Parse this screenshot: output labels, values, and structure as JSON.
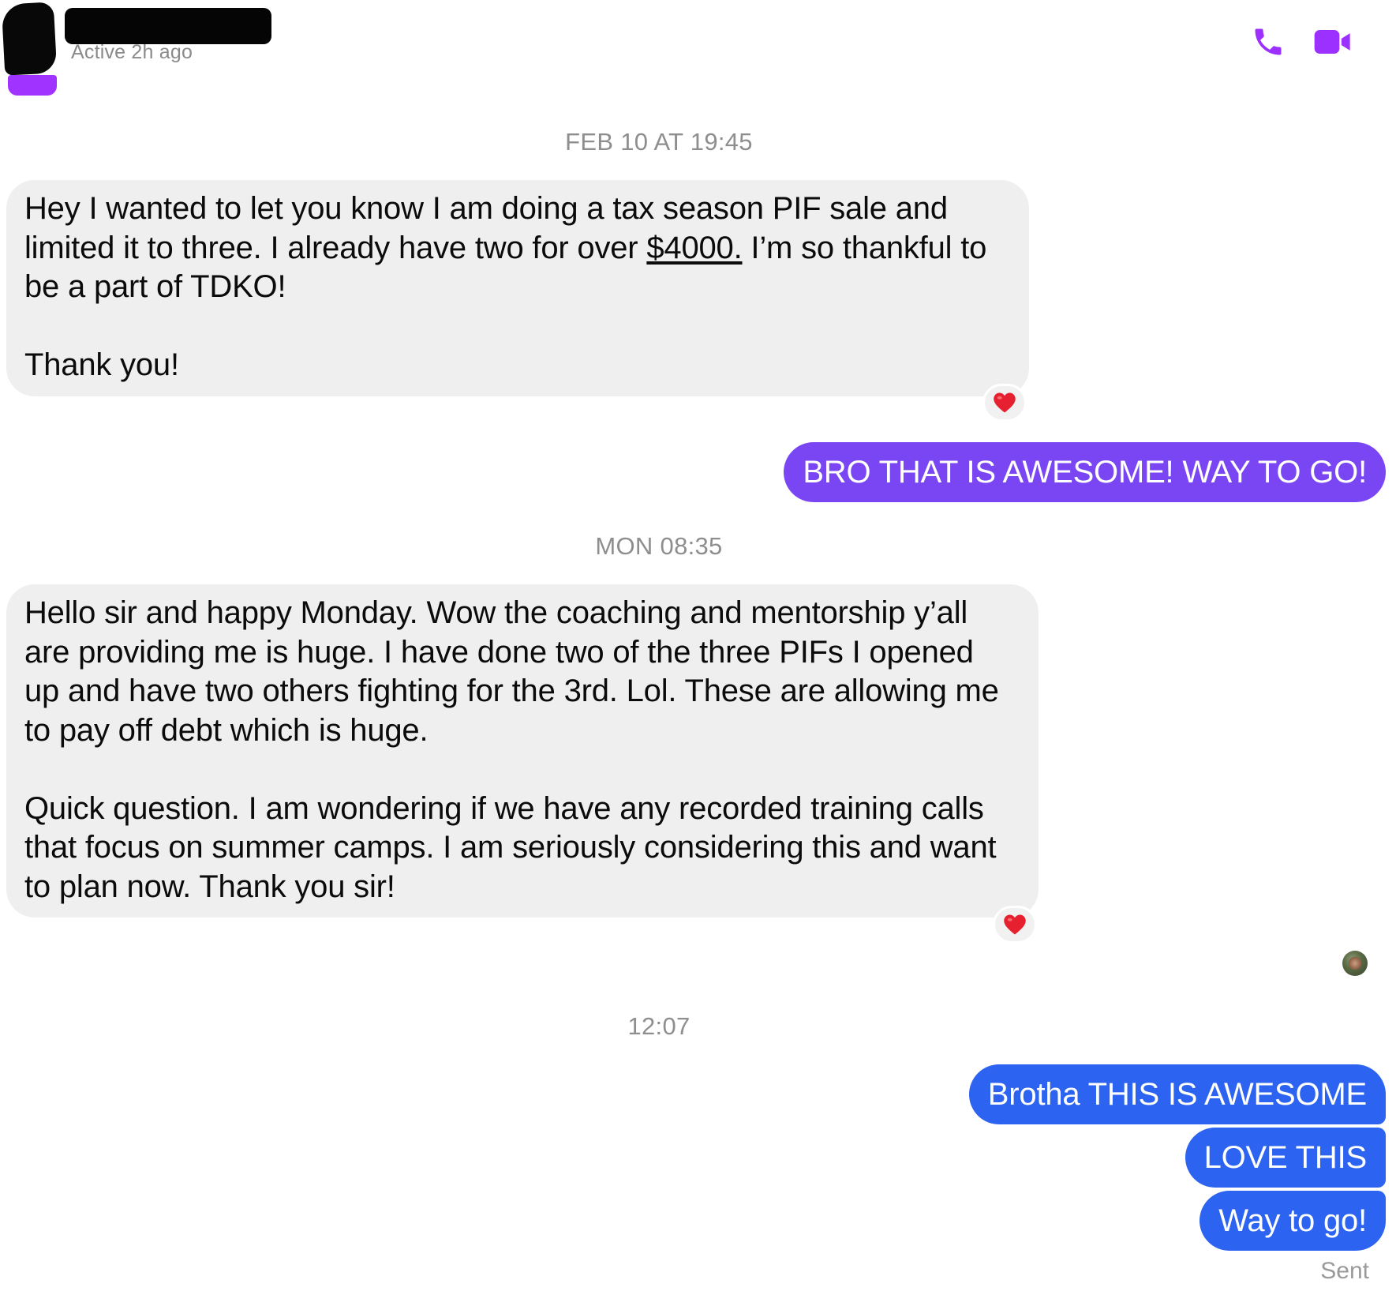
{
  "header": {
    "contact_name": "",
    "status": "Active 2h ago",
    "phone_icon": "phone-icon",
    "video_icon": "video-camera-icon",
    "accent_color": "#9b30ff"
  },
  "thread": {
    "timestamps": [
      "FEB 10 AT 19:45",
      "MON 08:35",
      "12:07"
    ],
    "messages": [
      {
        "sender": "contact",
        "paragraphs": [
          {
            "before": "Hey I wanted to let you know I am doing a tax season PIF sale and limited it to three. I already have two for over ",
            "underlined": "$4000.",
            "after": " I’m so thankful to be a part of TDKO!"
          },
          {
            "text": "Thank you!"
          }
        ],
        "reaction": "red-heart"
      },
      {
        "sender": "me",
        "text": "BRO THAT IS AWESOME! WAY TO GO!"
      },
      {
        "sender": "contact",
        "paragraphs": [
          {
            "text": "Hello sir and happy Monday. Wow the coaching and mentorship y’all are providing me is huge. I have done two of the three PIFs I opened up and have two others fighting for the 3rd. Lol. These are allowing me to pay off debt which is huge."
          },
          {
            "text": "Quick question. I am wondering if we have any recorded training calls that focus on summer camps. I am seriously considering this and want to plan now. Thank you sir!"
          }
        ],
        "reaction": "red-heart"
      },
      {
        "sender": "me",
        "text": "Brotha THIS IS AWESOME"
      },
      {
        "sender": "me",
        "text": "LOVE THIS"
      },
      {
        "sender": "me",
        "text": "Way to go!"
      }
    ],
    "delivery_status": "Sent"
  },
  "colors": {
    "incoming_bubble": "#efefef",
    "outgoing_purple": "#7a46f4",
    "outgoing_blue": "#2c63f0",
    "timestamp_text": "#8e8e8e",
    "heart": "#e6202e"
  }
}
